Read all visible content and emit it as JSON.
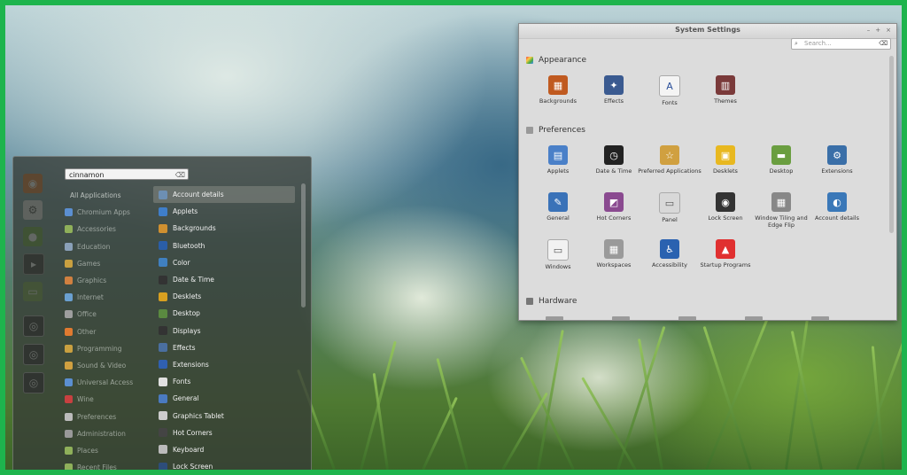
{
  "menu": {
    "search_value": "cinnamon",
    "categories": [
      "All Applications",
      "Chromium Apps",
      "Accessories",
      "Education",
      "Games",
      "Graphics",
      "Internet",
      "Office",
      "Other",
      "Programming",
      "Sound & Video",
      "Universal Access",
      "Wine",
      "Preferences",
      "Administration",
      "Places",
      "Recent Files"
    ],
    "apps": [
      "Account details",
      "Applets",
      "Backgrounds",
      "Bluetooth",
      "Color",
      "Date & Time",
      "Desklets",
      "Desktop",
      "Displays",
      "Effects",
      "Extensions",
      "Fonts",
      "General",
      "Graphics Tablet",
      "Hot Corners",
      "Keyboard",
      "Lock Screen"
    ]
  },
  "settings": {
    "title": "System Settings",
    "search_placeholder": "Search...",
    "sections": {
      "appearance": "Appearance",
      "preferences": "Preferences",
      "hardware": "Hardware"
    },
    "appearance_items": [
      "Backgrounds",
      "Effects",
      "Fonts",
      "Themes"
    ],
    "preferences_items": [
      "Applets",
      "Date & Time",
      "Preferred Applications",
      "Desklets",
      "Desktop",
      "Extensions",
      "General",
      "Hot Corners",
      "Panel",
      "Lock Screen",
      "Window Tiling and Edge Flip",
      "Account details",
      "Windows",
      "Workspaces",
      "Accessibility",
      "Startup Programs"
    ]
  }
}
